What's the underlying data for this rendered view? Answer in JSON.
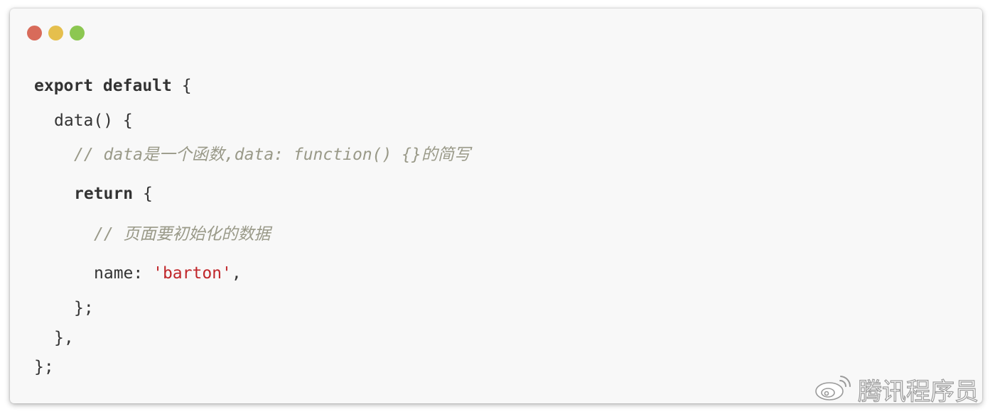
{
  "window": {
    "controls": [
      {
        "name": "close",
        "color": "#d86b5a"
      },
      {
        "name": "minimize",
        "color": "#e5bf4d"
      },
      {
        "name": "maximize",
        "color": "#8cc751"
      }
    ]
  },
  "code": {
    "line1_kw": "export default",
    "line1_rest": " {",
    "line2": "data() {",
    "line3_comment": "// data是一个函数,data: function() {}的简写",
    "line4_kw": "return",
    "line4_rest": " {",
    "line5_comment": "// 页面要初始化的数据",
    "line6_key": "name: ",
    "line6_str": "'barton'",
    "line6_tail": ",",
    "line7": "};",
    "line8": "},",
    "line9": "};"
  },
  "watermark": {
    "text": "腾讯程序员",
    "icon": "weibo-icon"
  }
}
